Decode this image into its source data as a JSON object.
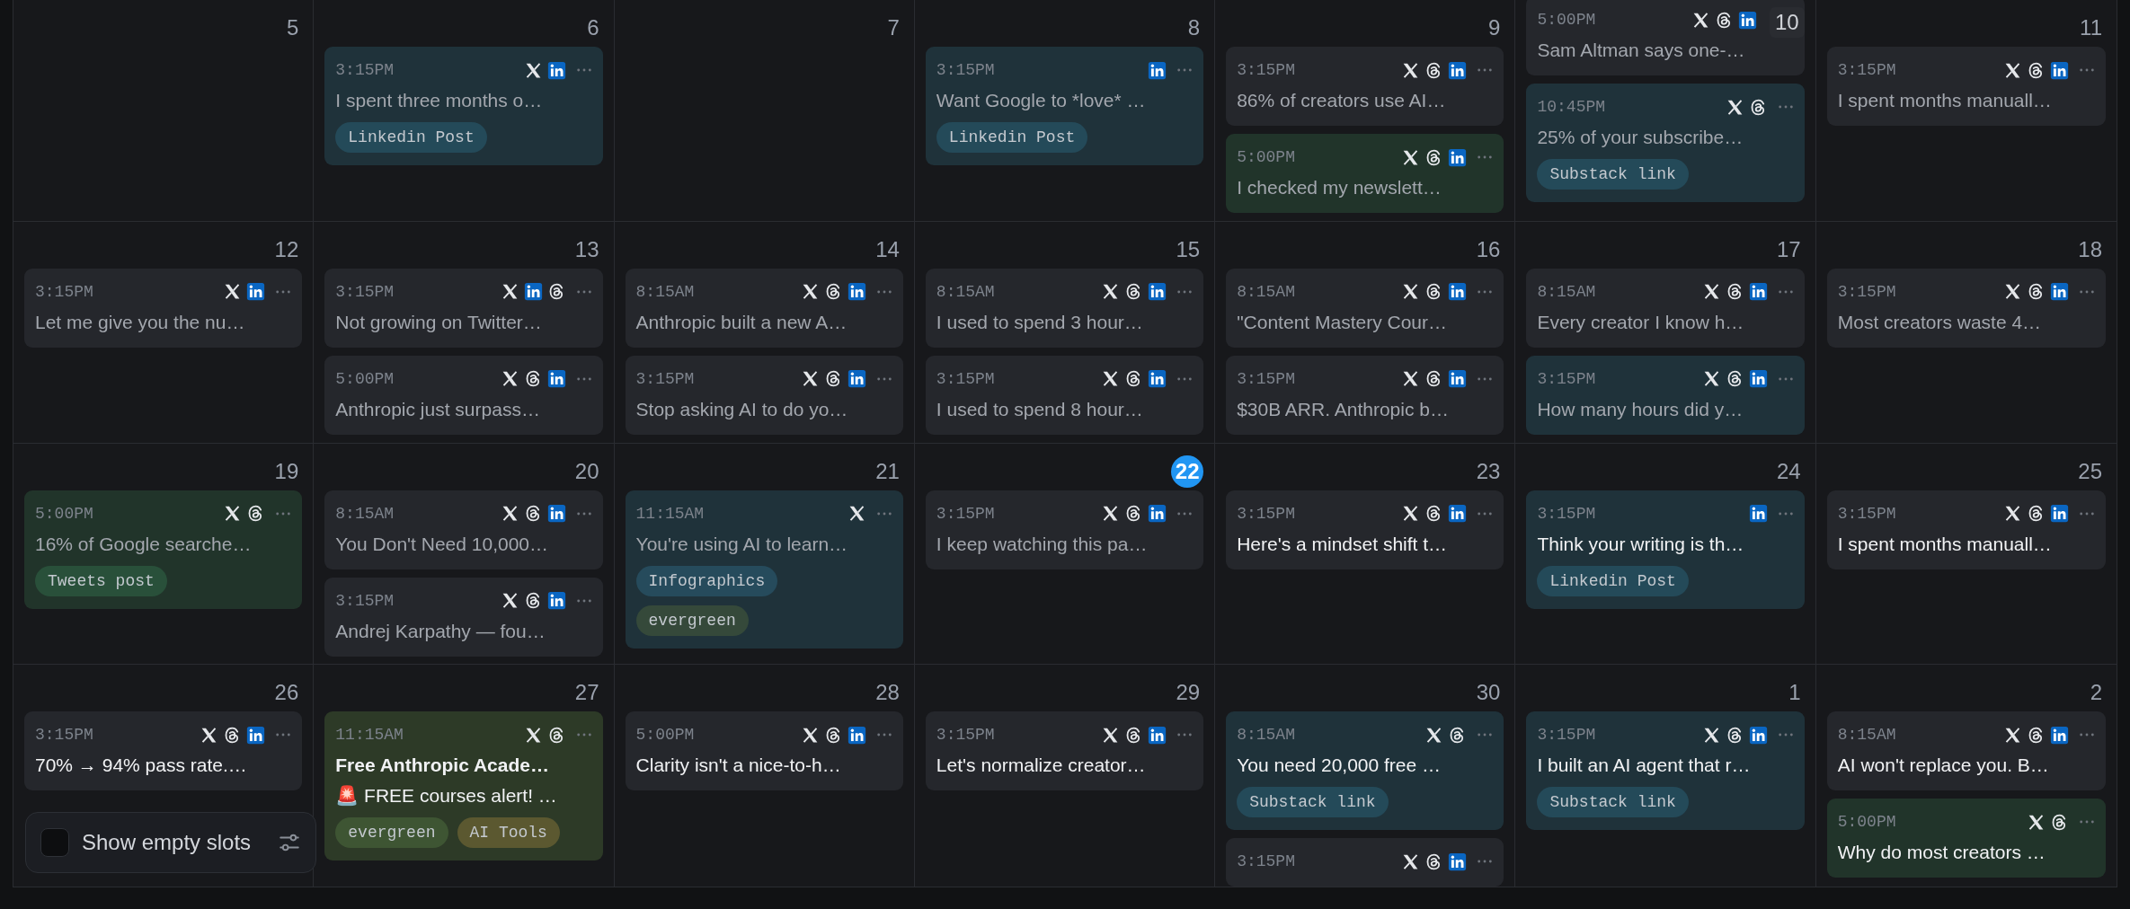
{
  "weeks": [
    {
      "days": [
        {
          "day": "5",
          "today": false,
          "scrolled": false
        },
        {
          "day": "6",
          "today": false,
          "scrolled": false,
          "posts": [
            {
              "time": "3:15PM",
              "platforms": [
                {
                  "kind": "x"
                },
                {
                  "kind": "linkedin"
                }
              ],
              "text": "I spent three months o…",
              "past": true,
              "color": "#1f323a",
              "tags": [
                {
                  "label": "Linkedin Post",
                  "color": "#244a59"
                }
              ]
            }
          ]
        },
        {
          "day": "7",
          "today": false,
          "scrolled": false
        },
        {
          "day": "8",
          "today": false,
          "scrolled": false,
          "posts": [
            {
              "time": "3:15PM",
              "platforms": [
                {
                  "kind": "linkedin"
                }
              ],
              "text": "Want Google to *love* …",
              "past": true,
              "color": "#1f323a",
              "tags": [
                {
                  "label": "Linkedin Post",
                  "color": "#244a59"
                }
              ]
            }
          ]
        },
        {
          "day": "9",
          "today": false,
          "scrolled": false,
          "posts": [
            {
              "time": "3:15PM",
              "platforms": [
                {
                  "kind": "x"
                },
                {
                  "kind": "threads"
                },
                {
                  "kind": "linkedin"
                }
              ],
              "text": "86% of creators use AI…",
              "past": true,
              "color": "#25272c"
            },
            {
              "time": "5:00PM",
              "platforms": [
                {
                  "kind": "x"
                },
                {
                  "kind": "threads"
                },
                {
                  "kind": "linkedin"
                }
              ],
              "text": "I checked my newslett…",
              "past": true,
              "color": "#21342a"
            }
          ]
        },
        {
          "day": "10",
          "today": false,
          "scrolled": true,
          "posts": [
            {
              "time": "5:00PM",
              "platforms": [
                {
                  "kind": "x"
                },
                {
                  "kind": "threads"
                },
                {
                  "kind": "linkedin"
                }
              ],
              "text": "Sam Altman says one-…",
              "past": true,
              "color": "#25272c"
            },
            {
              "time": "10:45PM",
              "platforms": [
                {
                  "kind": "x"
                },
                {
                  "kind": "threads"
                }
              ],
              "text": "25% of your subscribe…",
              "past": true,
              "color": "#1f323a",
              "tags": [
                {
                  "label": "Substack link",
                  "color": "#244a59"
                }
              ]
            }
          ]
        },
        {
          "day": "11",
          "today": false,
          "scrolled": false,
          "posts": [
            {
              "time": "3:15PM",
              "platforms": [
                {
                  "kind": "x"
                },
                {
                  "kind": "threads"
                },
                {
                  "kind": "linkedin"
                }
              ],
              "text": "I spent months manuall…",
              "past": true,
              "color": "#25272c"
            }
          ]
        }
      ]
    },
    {
      "days": [
        {
          "day": "12",
          "today": false,
          "scrolled": false,
          "posts": [
            {
              "time": "3:15PM",
              "platforms": [
                {
                  "kind": "x"
                },
                {
                  "kind": "linkedin"
                }
              ],
              "text": "Let me give you the nu…",
              "past": true,
              "color": "#25272c"
            }
          ]
        },
        {
          "day": "13",
          "today": false,
          "scrolled": false,
          "posts": [
            {
              "time": "3:15PM",
              "platforms": [
                {
                  "kind": "x"
                },
                {
                  "kind": "linkedin"
                },
                {
                  "kind": "threads"
                }
              ],
              "text": "Not growing on Twitter…",
              "past": true,
              "color": "#25272c"
            },
            {
              "time": "5:00PM",
              "platforms": [
                {
                  "kind": "x"
                },
                {
                  "kind": "threads"
                },
                {
                  "kind": "linkedin"
                }
              ],
              "text": "Anthropic just surpass…",
              "past": true,
              "color": "#25272c"
            }
          ]
        },
        {
          "day": "14",
          "today": false,
          "scrolled": false,
          "posts": [
            {
              "time": "8:15AM",
              "platforms": [
                {
                  "kind": "x"
                },
                {
                  "kind": "threads"
                },
                {
                  "kind": "linkedin"
                }
              ],
              "text": "Anthropic built a new A…",
              "past": true,
              "color": "#25272c"
            },
            {
              "time": "3:15PM",
              "platforms": [
                {
                  "kind": "x"
                },
                {
                  "kind": "threads"
                },
                {
                  "kind": "linkedin"
                }
              ],
              "text": "Stop asking AI to do yo…",
              "past": true,
              "color": "#25272c"
            }
          ]
        },
        {
          "day": "15",
          "today": false,
          "scrolled": false,
          "posts": [
            {
              "time": "8:15AM",
              "platforms": [
                {
                  "kind": "x"
                },
                {
                  "kind": "threads"
                },
                {
                  "kind": "linkedin"
                }
              ],
              "text": "I used to spend 3 hour…",
              "past": true,
              "color": "#25272c"
            },
            {
              "time": "3:15PM",
              "platforms": [
                {
                  "kind": "x"
                },
                {
                  "kind": "threads"
                },
                {
                  "kind": "linkedin"
                }
              ],
              "text": "I used to spend 8 hour…",
              "past": true,
              "color": "#25272c"
            }
          ]
        },
        {
          "day": "16",
          "today": false,
          "scrolled": false,
          "posts": [
            {
              "time": "8:15AM",
              "platforms": [
                {
                  "kind": "x"
                },
                {
                  "kind": "threads"
                },
                {
                  "kind": "linkedin"
                }
              ],
              "text": "\"Content Mastery Cour…",
              "past": true,
              "color": "#25272c"
            },
            {
              "time": "3:15PM",
              "platforms": [
                {
                  "kind": "x"
                },
                {
                  "kind": "threads"
                },
                {
                  "kind": "linkedin"
                }
              ],
              "text": "$30B ARR. Anthropic b…",
              "past": true,
              "color": "#25272c"
            }
          ]
        },
        {
          "day": "17",
          "today": false,
          "scrolled": false,
          "posts": [
            {
              "time": "8:15AM",
              "platforms": [
                {
                  "kind": "x"
                },
                {
                  "kind": "threads"
                },
                {
                  "kind": "linkedin"
                }
              ],
              "text": "Every creator I know h…",
              "past": true,
              "color": "#25272c"
            },
            {
              "time": "3:15PM",
              "platforms": [
                {
                  "kind": "x"
                },
                {
                  "kind": "threads"
                },
                {
                  "kind": "linkedin"
                }
              ],
              "text": "How many hours did y…",
              "past": true,
              "color": "#1f323a"
            }
          ]
        },
        {
          "day": "18",
          "today": false,
          "scrolled": false,
          "posts": [
            {
              "time": "3:15PM",
              "platforms": [
                {
                  "kind": "x"
                },
                {
                  "kind": "threads"
                },
                {
                  "kind": "linkedin"
                }
              ],
              "text": "Most creators waste 4…",
              "past": true,
              "color": "#25272c"
            }
          ]
        }
      ]
    },
    {
      "days": [
        {
          "day": "19",
          "today": false,
          "scrolled": false,
          "posts": [
            {
              "time": "5:00PM",
              "platforms": [
                {
                  "kind": "x"
                },
                {
                  "kind": "threads"
                }
              ],
              "text": "16% of Google searche…",
              "past": true,
              "color": "#21342a",
              "tags": [
                {
                  "label": "Tweets post",
                  "color": "#29503a"
                }
              ]
            }
          ]
        },
        {
          "day": "20",
          "today": false,
          "scrolled": false,
          "posts": [
            {
              "time": "8:15AM",
              "platforms": [
                {
                  "kind": "x"
                },
                {
                  "kind": "threads"
                },
                {
                  "kind": "linkedin"
                }
              ],
              "text": "You Don't Need 10,000…",
              "past": true,
              "color": "#25272c"
            },
            {
              "time": "3:15PM",
              "platforms": [
                {
                  "kind": "x"
                },
                {
                  "kind": "threads"
                },
                {
                  "kind": "linkedin"
                }
              ],
              "text": "Andrej Karpathy — fou…",
              "past": true,
              "color": "#25272c"
            }
          ]
        },
        {
          "day": "21",
          "today": false,
          "scrolled": false,
          "posts": [
            {
              "time": "11:15AM",
              "platforms": [
                {
                  "kind": "x"
                }
              ],
              "text": "You're using AI to learn…",
              "past": true,
              "color": "#1f323a",
              "tags": [
                {
                  "label": "Infographics",
                  "color": "#264b5c"
                },
                {
                  "label": "evergreen",
                  "color": "#35493a"
                }
              ]
            }
          ]
        },
        {
          "day": "22",
          "today": true,
          "scrolled": false,
          "posts": [
            {
              "time": "3:15PM",
              "platforms": [
                {
                  "kind": "x"
                },
                {
                  "kind": "threads"
                },
                {
                  "kind": "linkedin"
                }
              ],
              "text": "I keep watching this pa…",
              "past": true,
              "color": "#25272c"
            }
          ]
        },
        {
          "day": "23",
          "today": false,
          "scrolled": false,
          "posts": [
            {
              "time": "3:15PM",
              "platforms": [
                {
                  "kind": "x"
                },
                {
                  "kind": "threads"
                },
                {
                  "kind": "linkedin"
                }
              ],
              "text": "Here's a mindset shift t…",
              "past": false,
              "color": "#25272c"
            }
          ]
        },
        {
          "day": "24",
          "today": false,
          "scrolled": false,
          "posts": [
            {
              "time": "3:15PM",
              "platforms": [
                {
                  "kind": "linkedin"
                }
              ],
              "text": "Think your writing is th…",
              "past": false,
              "color": "#1f323a",
              "tags": [
                {
                  "label": "Linkedin Post",
                  "color": "#244a59"
                }
              ]
            }
          ]
        },
        {
          "day": "25",
          "today": false,
          "scrolled": false,
          "posts": [
            {
              "time": "3:15PM",
              "platforms": [
                {
                  "kind": "x"
                },
                {
                  "kind": "threads"
                },
                {
                  "kind": "linkedin"
                }
              ],
              "text": "I spent months manuall…",
              "past": false,
              "color": "#25272c"
            }
          ]
        }
      ]
    },
    {
      "days": [
        {
          "day": "26",
          "today": false,
          "scrolled": false,
          "posts": [
            {
              "time": "3:15PM",
              "platforms": [
                {
                  "kind": "x"
                },
                {
                  "kind": "threads"
                },
                {
                  "kind": "linkedin"
                }
              ],
              "text": "70% → 94% pass rate.…",
              "past": false,
              "color": "#25272c"
            }
          ]
        },
        {
          "day": "27",
          "today": false,
          "scrolled": false,
          "posts": [
            {
              "time": "11:15AM",
              "platforms": [
                {
                  "kind": "x"
                },
                {
                  "kind": "threads"
                }
              ],
              "title": "Free Anthropic Acade…",
              "text": "🚨 FREE courses alert! …",
              "past": false,
              "color": "#2d3a27",
              "tags": [
                {
                  "label": "evergreen",
                  "color": "#3e5533"
                },
                {
                  "label": "AI Tools",
                  "color": "#5b5830"
                }
              ]
            }
          ]
        },
        {
          "day": "28",
          "today": false,
          "scrolled": false,
          "posts": [
            {
              "time": "5:00PM",
              "platforms": [
                {
                  "kind": "x"
                },
                {
                  "kind": "threads"
                },
                {
                  "kind": "linkedin"
                }
              ],
              "text": "Clarity isn't a nice-to-h…",
              "past": false,
              "color": "#25272c"
            }
          ]
        },
        {
          "day": "29",
          "today": false,
          "scrolled": false,
          "posts": [
            {
              "time": "3:15PM",
              "platforms": [
                {
                  "kind": "x"
                },
                {
                  "kind": "threads"
                },
                {
                  "kind": "linkedin"
                }
              ],
              "text": "Let's normalize creator…",
              "past": false,
              "color": "#25272c"
            }
          ]
        },
        {
          "day": "30",
          "today": false,
          "scrolled": false,
          "posts": [
            {
              "time": "8:15AM",
              "platforms": [
                {
                  "kind": "x"
                },
                {
                  "kind": "threads"
                }
              ],
              "text": "You need 20,000 free …",
              "past": false,
              "color": "#1f323a",
              "tags": [
                {
                  "label": "Substack link",
                  "color": "#244a59"
                }
              ]
            },
            {
              "time": "3:15PM",
              "platforms": [
                {
                  "kind": "x"
                },
                {
                  "kind": "threads"
                },
                {
                  "kind": "linkedin"
                }
              ],
              "color": "#25272c"
            }
          ]
        },
        {
          "day": "1",
          "today": false,
          "scrolled": false,
          "posts": [
            {
              "time": "3:15PM",
              "platforms": [
                {
                  "kind": "x"
                },
                {
                  "kind": "threads"
                },
                {
                  "kind": "linkedin"
                }
              ],
              "text": "I built an AI agent that r…",
              "past": false,
              "color": "#1f323a",
              "tags": [
                {
                  "label": "Substack link",
                  "color": "#244a59"
                }
              ]
            }
          ]
        },
        {
          "day": "2",
          "today": false,
          "scrolled": false,
          "posts": [
            {
              "time": "8:15AM",
              "platforms": [
                {
                  "kind": "x"
                },
                {
                  "kind": "threads"
                },
                {
                  "kind": "linkedin"
                }
              ],
              "text": "AI won't replace you. B…",
              "past": false,
              "color": "#25272c"
            },
            {
              "time": "5:00PM",
              "platforms": [
                {
                  "kind": "x"
                },
                {
                  "kind": "threads"
                }
              ],
              "text": "Why do most creators …",
              "past": false,
              "color": "#21342a"
            }
          ]
        }
      ]
    }
  ],
  "empty_slots_toggle": {
    "label": "Show empty slots",
    "checked": false
  }
}
